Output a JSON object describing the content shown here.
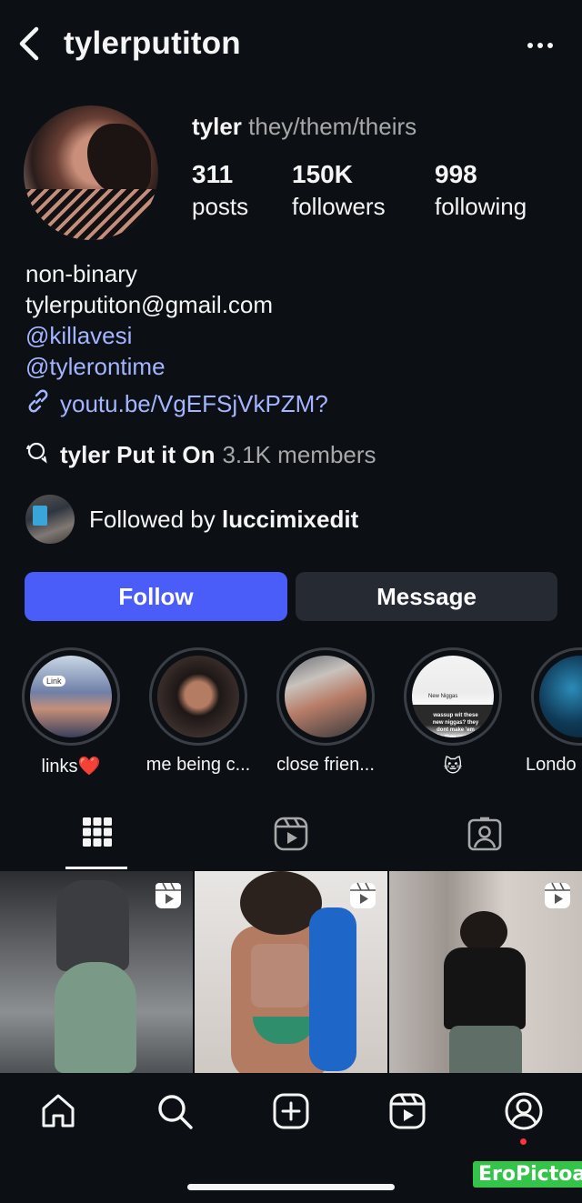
{
  "header": {
    "username": "tylerputiton"
  },
  "profile": {
    "name": "tyler",
    "pronouns": "they/them/theirs",
    "stats": [
      {
        "value": "311",
        "label": "posts"
      },
      {
        "value": "150K",
        "label": "followers"
      },
      {
        "value": "998",
        "label": "following"
      }
    ]
  },
  "bio": {
    "lines": [
      "non-binary",
      "tylerputiton@gmail.com"
    ],
    "mentions": [
      "@killavesi",
      "@tylerontime"
    ],
    "url": "youtu.be/VgEFSjVkPZM?"
  },
  "channel": {
    "name": "tyler Put it On",
    "members": "3.1K members"
  },
  "followed_by": {
    "prefix": "Followed by ",
    "user": "luccimixedit"
  },
  "buttons": {
    "follow": "Follow",
    "message": "Message"
  },
  "highlights": [
    {
      "label": "links❤️",
      "mini_text": "Link"
    },
    {
      "label": "me being c..."
    },
    {
      "label": "close frien..."
    },
    {
      "label": "🐱",
      "mini_title": "New Niggas",
      "mini_dark": "wassup wit these new niggas? they dont make 'em like they used to"
    },
    {
      "label": "Londo"
    }
  ],
  "tabs": [
    "grid",
    "reels",
    "tagged"
  ],
  "nav": [
    "home",
    "search",
    "create",
    "reels",
    "profile"
  ],
  "watermark": "EroPictoa",
  "colors": {
    "accent": "#4a5df9",
    "link": "#a4b4ff",
    "background": "#0c1014",
    "notification": "#ff3040"
  }
}
